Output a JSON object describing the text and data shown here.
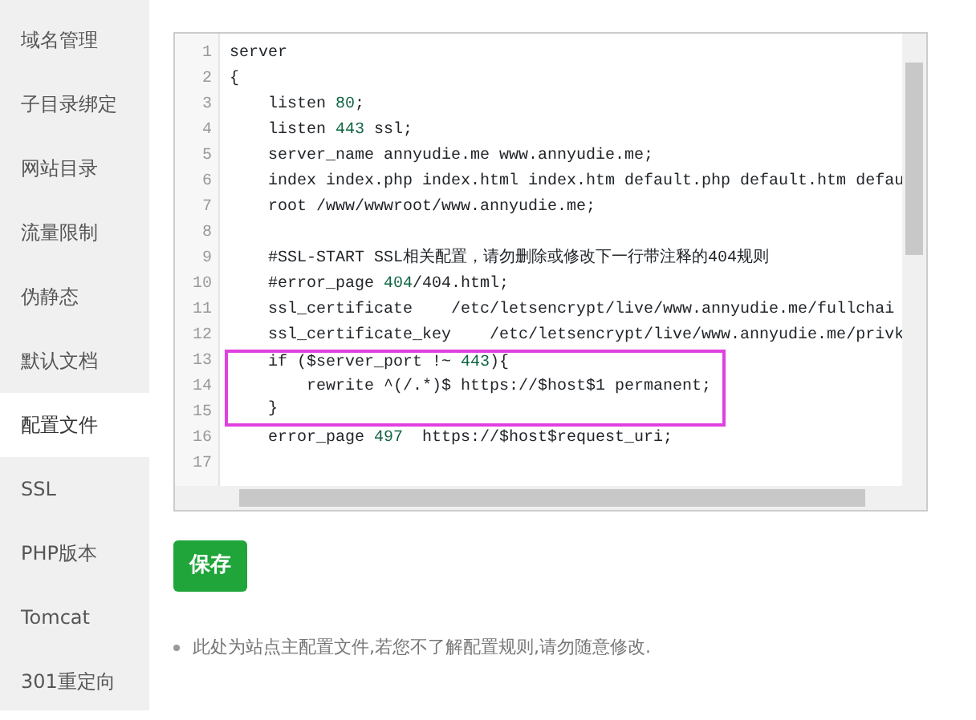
{
  "sidebar": {
    "items": [
      {
        "label": "域名管理",
        "selected": false
      },
      {
        "label": "子目录绑定",
        "selected": false
      },
      {
        "label": "网站目录",
        "selected": false
      },
      {
        "label": "流量限制",
        "selected": false
      },
      {
        "label": "伪静态",
        "selected": false
      },
      {
        "label": "默认文档",
        "selected": false
      },
      {
        "label": "配置文件",
        "selected": true
      },
      {
        "label": "SSL",
        "selected": false
      },
      {
        "label": "PHP版本",
        "selected": false
      },
      {
        "label": "Tomcat",
        "selected": false
      },
      {
        "label": "301重定向",
        "selected": false
      }
    ]
  },
  "editor": {
    "lines": [
      {
        "number": "1",
        "highlighted": false,
        "parts": [
          {
            "kind": "plain",
            "text": "server"
          }
        ]
      },
      {
        "number": "2",
        "highlighted": false,
        "parts": [
          {
            "kind": "plain",
            "text": "{"
          }
        ]
      },
      {
        "number": "3",
        "highlighted": false,
        "parts": [
          {
            "kind": "plain",
            "text": "    listen "
          },
          {
            "kind": "number",
            "text": "80"
          },
          {
            "kind": "plain",
            "text": ";"
          }
        ]
      },
      {
        "number": "4",
        "highlighted": false,
        "parts": [
          {
            "kind": "plain",
            "text": "    listen "
          },
          {
            "kind": "number",
            "text": "443"
          },
          {
            "kind": "plain",
            "text": " ssl;"
          }
        ]
      },
      {
        "number": "5",
        "highlighted": false,
        "parts": [
          {
            "kind": "plain",
            "text": "    server_name annyudie.me www.annyudie.me;"
          }
        ]
      },
      {
        "number": "6",
        "highlighted": false,
        "parts": [
          {
            "kind": "plain",
            "text": "    index index.php index.html index.htm default.php default.htm defau"
          }
        ]
      },
      {
        "number": "7",
        "highlighted": false,
        "parts": [
          {
            "kind": "plain",
            "text": "    root /www/wwwroot/www.annyudie.me;"
          }
        ]
      },
      {
        "number": "8",
        "highlighted": false
      },
      {
        "number": "9",
        "highlighted": false,
        "parts": [
          {
            "kind": "plain",
            "text": "    #SSL-START SSL相关配置，请勿删除或修改下一行带注释的404规则"
          }
        ]
      },
      {
        "number": "10",
        "highlighted": false,
        "parts": [
          {
            "kind": "plain",
            "text": "    #error_page "
          },
          {
            "kind": "number",
            "text": "404"
          },
          {
            "kind": "plain",
            "text": "/404.html;"
          }
        ]
      },
      {
        "number": "11",
        "highlighted": false,
        "parts": [
          {
            "kind": "plain",
            "text": "    ssl_certificate    /etc/letsencrypt/live/www.annyudie.me/fullchai"
          }
        ]
      },
      {
        "number": "12",
        "highlighted": false,
        "parts": [
          {
            "kind": "plain",
            "text": "    ssl_certificate_key    /etc/letsencrypt/live/www.annyudie.me/privk"
          }
        ]
      },
      {
        "number": "13",
        "highlighted": true,
        "parts": [
          {
            "kind": "plain",
            "text": "    if ($server_port !~ "
          },
          {
            "kind": "number",
            "text": "443"
          },
          {
            "kind": "plain",
            "text": "){"
          }
        ]
      },
      {
        "number": "14",
        "highlighted": true,
        "parts": [
          {
            "kind": "plain",
            "text": "        rewrite ^(/.*)$ https://$host$1 permanent;"
          }
        ]
      },
      {
        "number": "15",
        "highlighted": true,
        "parts": [
          {
            "kind": "plain",
            "text": "    }"
          }
        ]
      },
      {
        "number": "16",
        "highlighted": false,
        "parts": [
          {
            "kind": "plain",
            "text": "    error_page "
          },
          {
            "kind": "number",
            "text": "497"
          },
          {
            "kind": "plain",
            "text": "  https://$host$request_uri;"
          }
        ]
      },
      {
        "number": "17",
        "highlighted": false
      }
    ]
  },
  "save_button": "保存",
  "note": "此处为站点主配置文件,若您不了解配置规则,请勿随意修改."
}
